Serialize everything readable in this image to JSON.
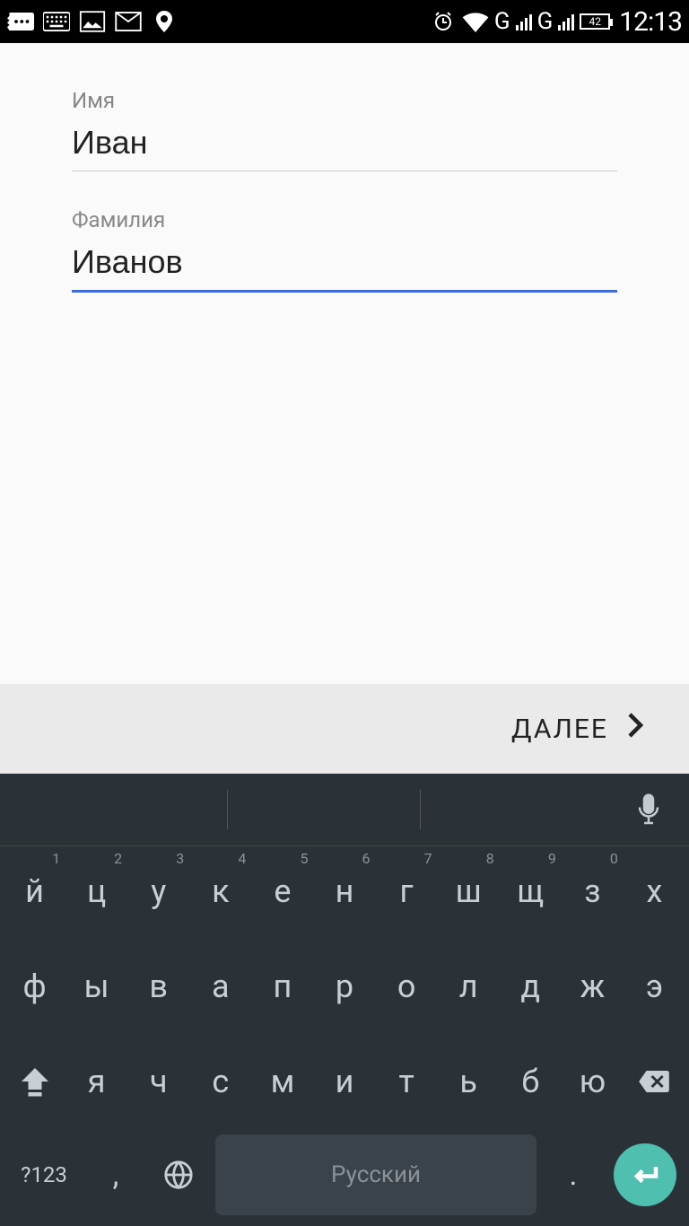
{
  "status": {
    "battery": "42",
    "time": "12:13",
    "net1": "G",
    "net2": "G"
  },
  "form": {
    "first_label": "Имя",
    "first_value": "Иван",
    "last_label": "Фамилия",
    "last_value": "Иванов"
  },
  "actions": {
    "next": "ДАЛЕЕ"
  },
  "keyboard": {
    "language": "Русский",
    "sym": "?123",
    "row1": [
      {
        "c": "й",
        "h": "1"
      },
      {
        "c": "ц",
        "h": "2"
      },
      {
        "c": "у",
        "h": "3"
      },
      {
        "c": "к",
        "h": "4"
      },
      {
        "c": "е",
        "h": "5"
      },
      {
        "c": "н",
        "h": "6"
      },
      {
        "c": "г",
        "h": "7"
      },
      {
        "c": "ш",
        "h": "8"
      },
      {
        "c": "щ",
        "h": "9"
      },
      {
        "c": "з",
        "h": "0"
      },
      {
        "c": "х",
        "h": ""
      }
    ],
    "row2": [
      "ф",
      "ы",
      "в",
      "а",
      "п",
      "р",
      "о",
      "л",
      "д",
      "ж",
      "э"
    ],
    "row3": [
      "я",
      "ч",
      "с",
      "м",
      "и",
      "т",
      "ь",
      "б",
      "ю"
    ],
    "comma": ",",
    "dot": "."
  }
}
